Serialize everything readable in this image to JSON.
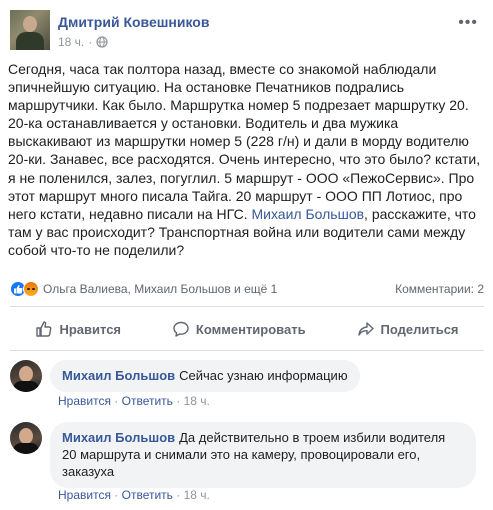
{
  "post": {
    "author": "Дмитрий Ковешников",
    "time": "18 ч.",
    "separator": "·",
    "text_lines": [
      "Сегодня, часа так полтора назад, вместе со знакомой наблюдали",
      "эпичнейшую ситуацию. На остановке Печатников подрались",
      "маршрутчики. Как было. Маршрутка номер 5 подрезает маршрутку 20.",
      "20-ка останавливается у остановки. Водитель и два мужика",
      "выскакивают из маршрутки номер 5 (228 г/н) и дали в морду водителю",
      "20-ки. Занавес, все расходятся. Очень интересно, что это было? кстати,",
      "я не поленился, залез, погуглил. 5 маршрут - ООО «ПежоСервис». Про",
      "этот маршрут много писала Тайга. 20 маршрут - ООО ПП Лотиос, про",
      "него кстати, недавно писали на НГС."
    ],
    "mention": "Михаил Большов",
    "text_after_mention_1": ", расскажите, что",
    "text_line_10_rest": "там у вас происходит? Транспортная война или водители сами между",
    "text_line_11": "собой что-то не поделили?"
  },
  "reactions": {
    "people": "Ольга Валиева, Михаил Большов и ещё 1",
    "comments": "Комментарии: 2",
    "icons": [
      "like-icon",
      "angry-icon"
    ]
  },
  "actions": {
    "like": "Нравится",
    "comment": "Комментировать",
    "share": "Поделиться"
  },
  "comments": [
    {
      "author": "Михаил Большов",
      "text": "Сейчас узнаю информацию",
      "like_label": "Нравится",
      "reply_label": "Ответить",
      "time": "18 ч."
    },
    {
      "author": "Михаил Большов",
      "text_line_1": "Да действительно в троем избили водителя",
      "text_line_2": "20 маршрута и снимали это на камеру, провоцировали его,",
      "text_line_3": "заказуха",
      "like_label": "Нравится",
      "reply_label": "Ответить",
      "time": "18 ч."
    }
  ],
  "colors": {
    "link": "#385898",
    "meta": "#90949c",
    "like_blue": "#1877f2"
  }
}
